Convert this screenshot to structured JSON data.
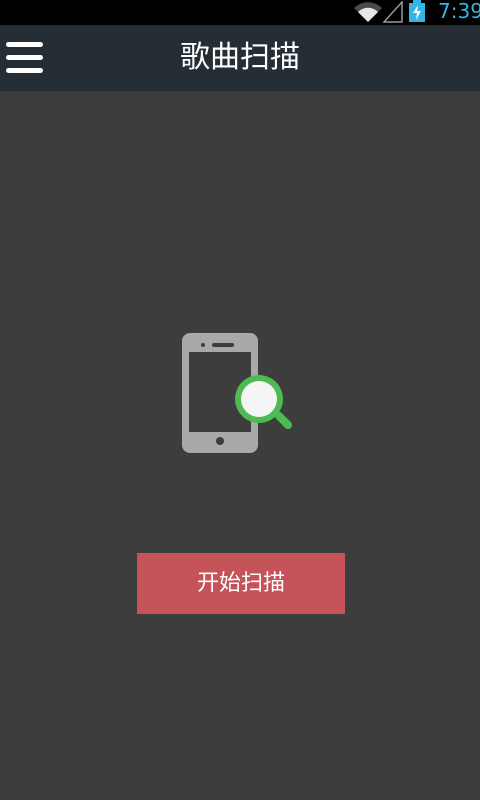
{
  "status_bar": {
    "time": "7:39",
    "icons": [
      "wifi-icon",
      "signal-icon",
      "battery-charging-icon"
    ],
    "time_color": "#33b5e5"
  },
  "app_bar": {
    "title": "歌曲扫描",
    "menu_icon": "hamburger-menu-icon",
    "background": "#252d35"
  },
  "main": {
    "illustration": "phone-search-icon",
    "start_button_label": "开始扫描",
    "start_button_color": "#c4535a",
    "background": "#3d3d3d"
  }
}
